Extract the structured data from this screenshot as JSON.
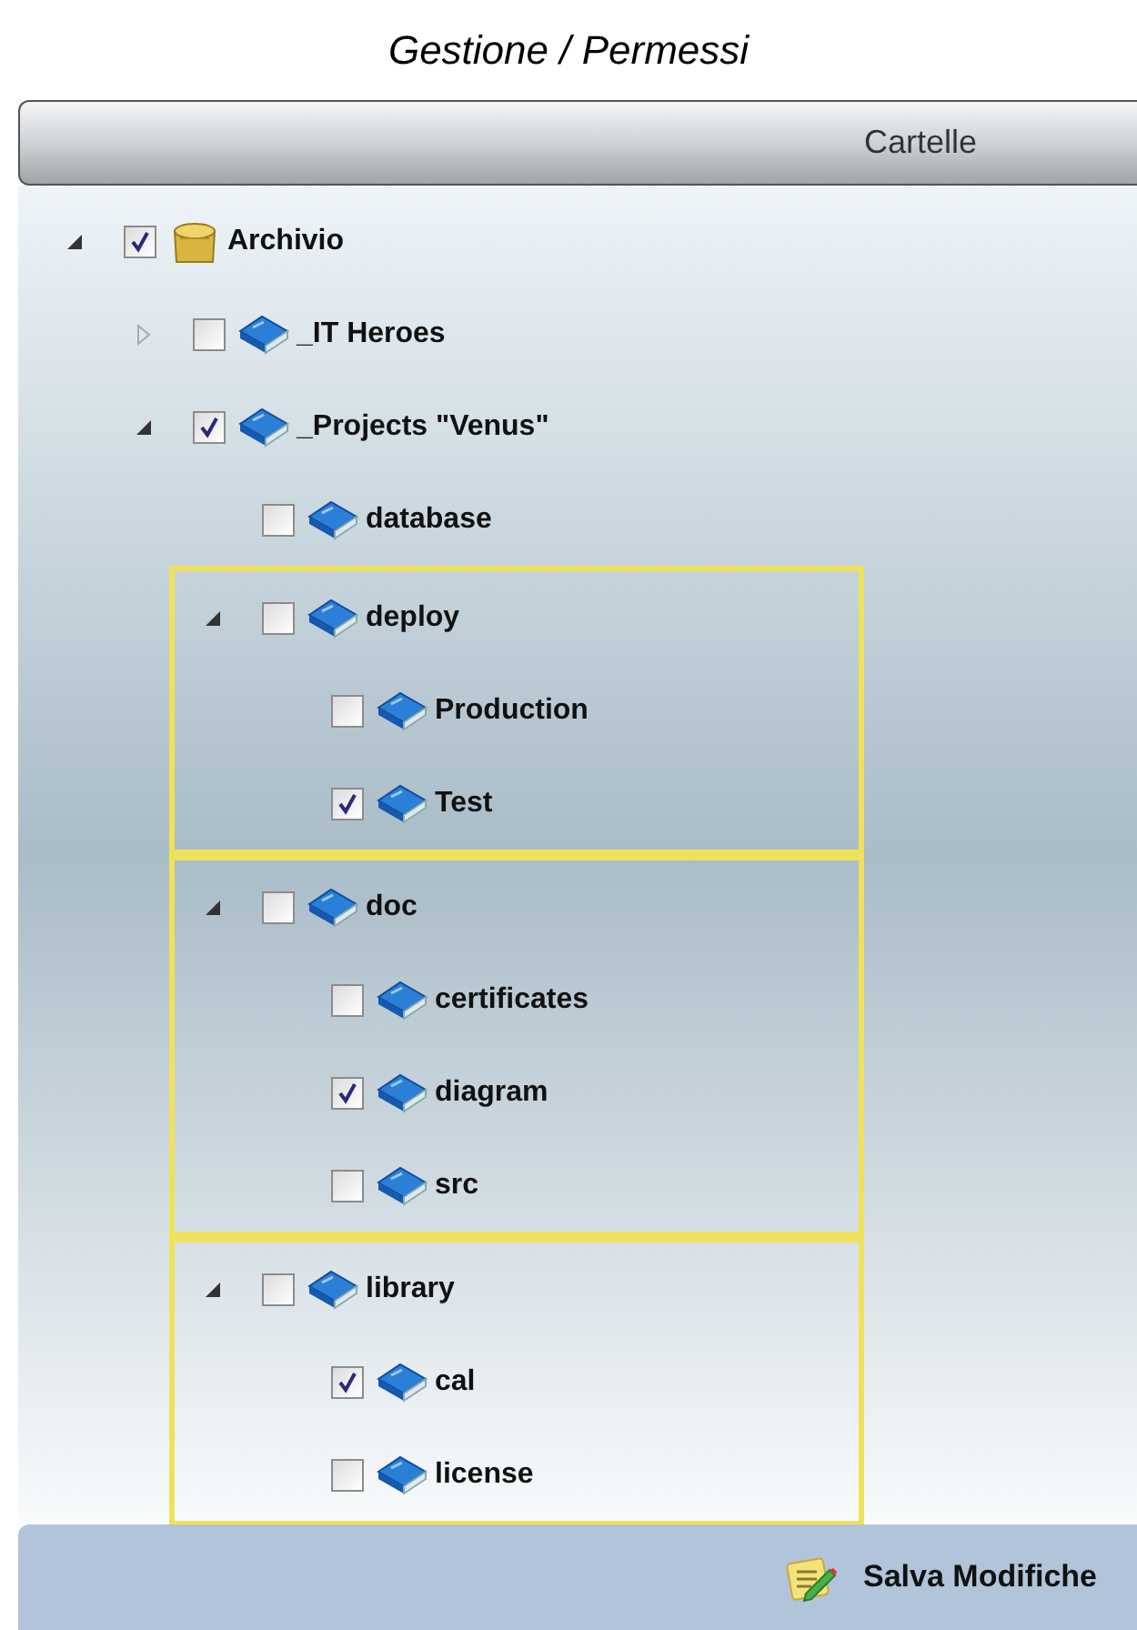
{
  "title": "Gestione / Permessi",
  "header": "Cartelle",
  "tree": [
    {
      "label": "Archivio",
      "kind": "archive",
      "checked": true,
      "expanded": true,
      "highlighted": false,
      "children": [
        {
          "label": "_IT Heroes",
          "kind": "folder",
          "checked": false,
          "expanded": false,
          "highlighted": false
        },
        {
          "label": "_Projects \"Venus\"",
          "kind": "folder",
          "checked": true,
          "expanded": true,
          "highlighted": false,
          "children": [
            {
              "label": "database",
              "kind": "folder",
              "checked": false,
              "highlighted": false
            },
            {
              "label": "deploy",
              "kind": "folder",
              "checked": false,
              "expanded": true,
              "highlighted": true,
              "children": [
                {
                  "label": "Production",
                  "kind": "folder",
                  "checked": false,
                  "highlighted": false
                },
                {
                  "label": "Test",
                  "kind": "folder",
                  "checked": true,
                  "highlighted": false
                }
              ]
            },
            {
              "label": "doc",
              "kind": "folder",
              "checked": false,
              "expanded": true,
              "highlighted": true,
              "children": [
                {
                  "label": "certificates",
                  "kind": "folder",
                  "checked": false,
                  "highlighted": false
                },
                {
                  "label": "diagram",
                  "kind": "folder",
                  "checked": true,
                  "highlighted": false
                },
                {
                  "label": "src",
                  "kind": "folder",
                  "checked": false,
                  "highlighted": false
                }
              ]
            },
            {
              "label": "library",
              "kind": "folder",
              "checked": false,
              "expanded": true,
              "highlighted": true,
              "children": [
                {
                  "label": "cal",
                  "kind": "folder",
                  "checked": true,
                  "highlighted": false
                },
                {
                  "label": "license",
                  "kind": "folder",
                  "checked": false,
                  "highlighted": false
                }
              ]
            }
          ]
        }
      ]
    }
  ],
  "save_button": "Salva Modifiche"
}
